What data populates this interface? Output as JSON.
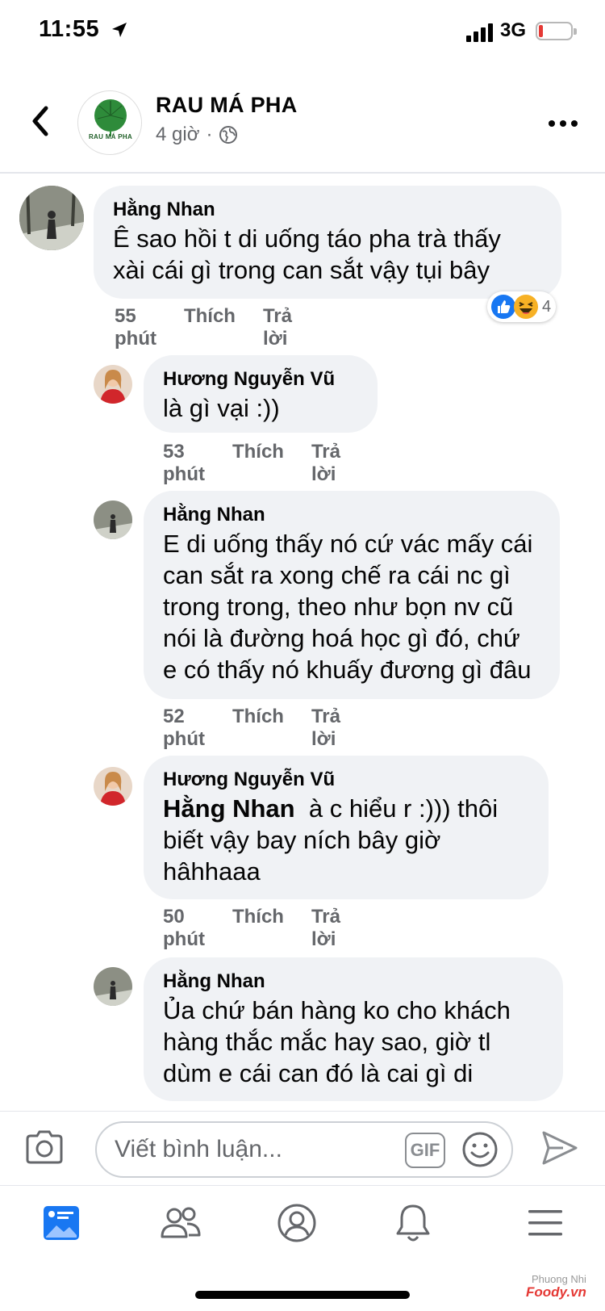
{
  "status_bar": {
    "time": "11:55",
    "network": "3G"
  },
  "header": {
    "page_name": "RAU MÁ PHA",
    "post_time": "4 giờ",
    "separator": "·",
    "logo_text": "RAU MÁ PHA"
  },
  "comments": [
    {
      "author": "Hằng Nhan",
      "lines": [
        "Ê sao hồi t di uống táo pha trà thấy",
        "xài cái gì trong can sắt vậy tụi bây"
      ],
      "time": "55 phút",
      "like": "Thích",
      "reply": "Trả lời",
      "reactions": {
        "types": [
          "like-icon",
          "haha-icon"
        ],
        "count": "4"
      }
    },
    {
      "author": "Hương Nguyễn Vũ",
      "lines": [
        "là gì vại :))"
      ],
      "time": "53 phút",
      "like": "Thích",
      "reply": "Trả lời"
    },
    {
      "author": "Hằng Nhan",
      "lines": [
        "E di uống thấy nó cứ vác mấy cái",
        "can sắt ra xong chế ra cái nc gì",
        "trong trong, theo như bọn nv cũ",
        "nói là đường hoá học gì đó, chứ",
        "e có thấy nó khuấy đương gì đâu"
      ],
      "time": "52 phút",
      "like": "Thích",
      "reply": "Trả lời"
    },
    {
      "author": "Hương Nguyễn Vũ",
      "mention": "Hằng Nhan",
      "first_line_rest": "à c hiểu r :))) thôi",
      "lines": [
        "biết vậy bay ních bây giờ",
        "hâhhaaa"
      ],
      "time": "50 phút",
      "like": "Thích",
      "reply": "Trả lời"
    },
    {
      "author": "Hằng Nhan",
      "lines": [
        "Ủa chứ bán hàng ko cho khách",
        "hàng thắc mắc hay sao, giờ tl",
        "dùm e cái can đó là cai gì di"
      ]
    }
  ],
  "composer": {
    "placeholder": "Viết bình luận...",
    "gif_label": "GIF"
  },
  "tabs": [
    "news-feed-icon",
    "friends-icon",
    "profile-icon",
    "notifications-icon",
    "menu-icon"
  ],
  "watermark": {
    "author": "Phuong Nhi",
    "brand": "Foody.vn"
  },
  "colors": {
    "bubble": "#f0f2f5",
    "meta": "#65676b",
    "like_blue": "#1877f2",
    "battery_low": "#e53935"
  }
}
